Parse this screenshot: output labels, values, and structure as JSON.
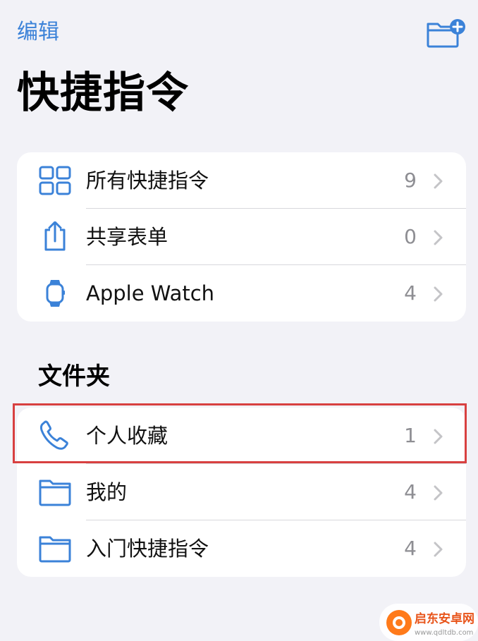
{
  "header": {
    "edit_label": "编辑",
    "title": "快捷指令",
    "new_folder_icon": "folder-plus-icon"
  },
  "library": {
    "items": [
      {
        "label": "所有快捷指令",
        "count": "9",
        "icon": "grid-icon"
      },
      {
        "label": "共享表单",
        "count": "0",
        "icon": "share-icon"
      },
      {
        "label": "Apple Watch",
        "count": "4",
        "icon": "apple-watch-icon"
      }
    ]
  },
  "folders": {
    "title": "文件夹",
    "items": [
      {
        "label": "个人收藏",
        "count": "1",
        "icon": "phone-icon",
        "highlighted": true
      },
      {
        "label": "我的",
        "count": "4",
        "icon": "folder-icon"
      },
      {
        "label": "入门快捷指令",
        "count": "4",
        "icon": "folder-icon"
      }
    ]
  },
  "watermark": {
    "brand_text": "启东安卓网",
    "site_text": "www.qdltdb.com"
  },
  "colors": {
    "accent": "#3b82d8",
    "highlight": "#d84040",
    "background": "#f2f2f7"
  }
}
